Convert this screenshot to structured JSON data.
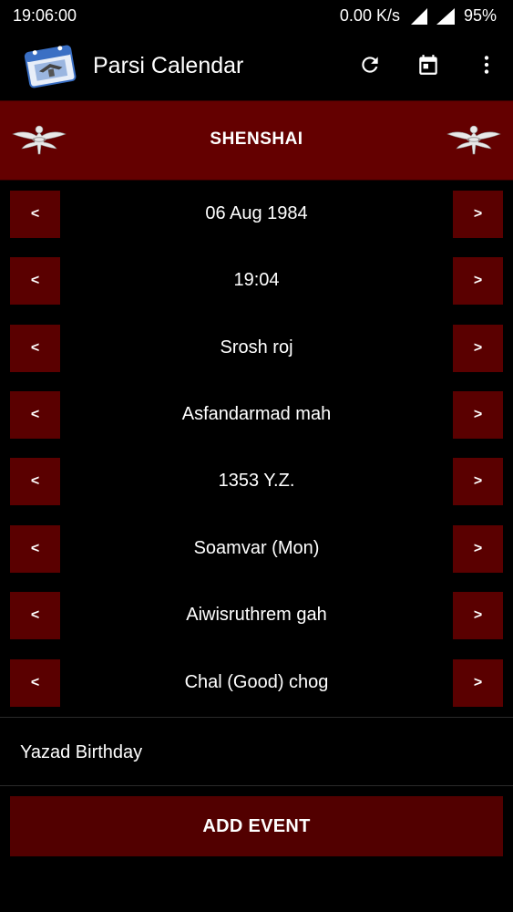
{
  "status_bar": {
    "time": "19:06:00",
    "network_speed": "0.00 K/s",
    "battery": "95%",
    "icons": [
      "signal-r-icon",
      "signal-4g-icon"
    ]
  },
  "app_bar": {
    "title": "Parsi Calendar",
    "logo_icon": "calendar-logo-icon",
    "actions": [
      "refresh-icon",
      "calendar-today-icon",
      "more-vert-icon"
    ]
  },
  "header": {
    "title": "SHENSHAI",
    "emblem_icon": "farohar-icon"
  },
  "rows": [
    {
      "name": "date",
      "value": "06 Aug 1984",
      "prev": "<",
      "next": ">"
    },
    {
      "name": "time",
      "value": "19:04",
      "prev": "<",
      "next": ">"
    },
    {
      "name": "roj",
      "value": "Srosh roj",
      "prev": "<",
      "next": ">"
    },
    {
      "name": "mah",
      "value": "Asfandarmad mah",
      "prev": "<",
      "next": ">"
    },
    {
      "name": "year",
      "value": "1353 Y.Z.",
      "prev": "<",
      "next": ">"
    },
    {
      "name": "weekday",
      "value": "Soamvar (Mon)",
      "prev": "<",
      "next": ">"
    },
    {
      "name": "gah",
      "value": "Aiwisruthrem gah",
      "prev": "<",
      "next": ">"
    },
    {
      "name": "chog",
      "value": "Chal (Good) chog",
      "prev": "<",
      "next": ">"
    }
  ],
  "event": {
    "label": "Yazad Birthday"
  },
  "add_event_button": {
    "label": "ADD EVENT"
  },
  "colors": {
    "background": "#000000",
    "header_band": "#640000",
    "button": "#5a0000",
    "add_button": "#520000",
    "text": "#ffffff"
  }
}
